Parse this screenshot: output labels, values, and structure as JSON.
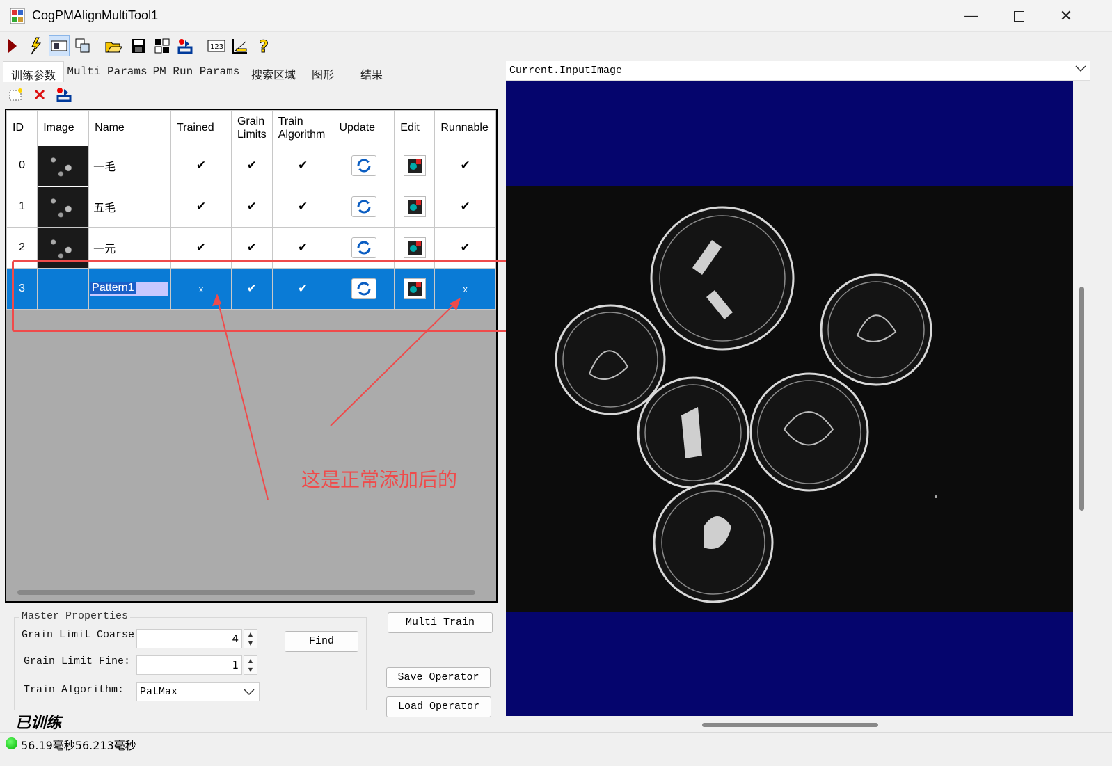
{
  "window": {
    "title": "CogPMAlignMultiTool1"
  },
  "toolbar": {
    "icons": [
      "run-icon",
      "live-run-icon",
      "image-view-icon",
      "copy-icon",
      "open-icon",
      "save-icon",
      "reset-icon",
      "load-image-icon",
      "numeric-icon",
      "measure-icon",
      "help-icon"
    ]
  },
  "tabs": [
    "训练参数",
    "Multi Params",
    "PM Run Params",
    "搜索区域",
    "图形",
    "结果"
  ],
  "grid": {
    "headers": [
      "ID",
      "Image",
      "Name",
      "Trained",
      "Grain Limits",
      "Train Algorithm",
      "Update",
      "Edit",
      "Runnable"
    ],
    "rows": [
      {
        "id": "0",
        "name": "一毛",
        "trained": "✔",
        "grain": "✔",
        "algo": "✔",
        "runnable": "✔"
      },
      {
        "id": "1",
        "name": "五毛",
        "trained": "✔",
        "grain": "✔",
        "algo": "✔",
        "runnable": "✔"
      },
      {
        "id": "2",
        "name": "一元",
        "trained": "✔",
        "grain": "✔",
        "algo": "✔",
        "runnable": "✔"
      },
      {
        "id": "3",
        "name": "Pattern1",
        "trained": "x",
        "grain": "✔",
        "algo": "✔",
        "runnable": "x"
      }
    ]
  },
  "annotation": {
    "text": "这是正常添加后的",
    "color": "#ef4b4b"
  },
  "master": {
    "legend": "Master Properties",
    "coarse_label": "Grain Limit Coarse:",
    "coarse_value": "4",
    "fine_label": "Grain Limit Fine:",
    "fine_value": "1",
    "algo_label": "Train Algorithm:",
    "algo_value": "PatMax",
    "find": "Find",
    "multi_train": "Multi Train",
    "save_op": "Save Operator",
    "load_op": "Load Operator"
  },
  "trained_label": "已训练",
  "status": {
    "text": "56.19毫秒56.213毫秒"
  },
  "viewer": {
    "selected": "Current.InputImage",
    "background": "#05056d"
  },
  "colors": {
    "selection": "#0a7bd6",
    "accent_red": "#ef4b4b"
  }
}
